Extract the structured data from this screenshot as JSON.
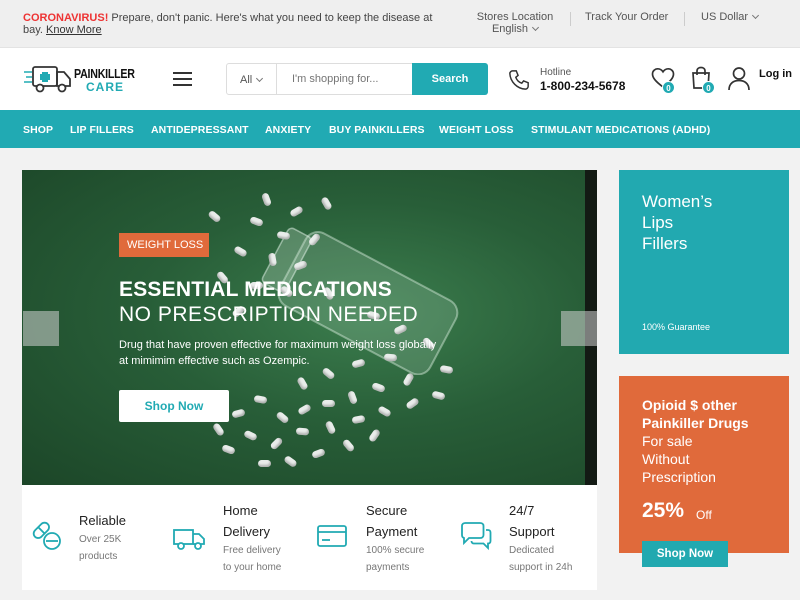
{
  "topbar": {
    "notice_strong": "CORONAVIRUS!",
    "notice_text": " Prepare, don't panic. Here's what you need to keep the disease at bay. ",
    "notice_link": "Know More",
    "stores_location": "Stores Location",
    "language": "English",
    "track_order": "Track Your Order",
    "currency": "US Dollar"
  },
  "header": {
    "logo_line1": "PAINKILLER",
    "logo_line2": "CARE",
    "search_category": "All",
    "search_placeholder": "I'm shopping for...",
    "search_button": "Search",
    "hotline_label": "Hotline",
    "hotline_number": "1-800-234-5678",
    "wishlist_count": "0",
    "cart_count": "0",
    "login_label": "Log in"
  },
  "nav": {
    "items": [
      "SHOP",
      "LIP FILLERS",
      "ANTIDEPRESSANT",
      "ANXIETY",
      "BUY PAINKILLERS",
      "WEIGHT LOSS",
      "STIMULANT MEDICATIONS (ADHD)"
    ]
  },
  "hero": {
    "tag": "WEIGHT LOSS",
    "title_line1": "ESSENTIAL MEDICATIONS",
    "title_line2": "NO PRESCRIPTION NEEDED",
    "description": "Drug that have proven effective for maximum weight loss globally  at mimimim effective such as Ozempic.",
    "button": "Shop Now"
  },
  "features": [
    {
      "title": "Reliable",
      "sub1": "Over 25K",
      "sub2": "products"
    },
    {
      "title1": "Home",
      "title2": "Delivery",
      "sub1": "Free delivery",
      "sub2": "to your home"
    },
    {
      "title1": "Secure",
      "title2": "Payment",
      "sub1": "100% secure",
      "sub2": "payments"
    },
    {
      "title1": "24/7",
      "title2": "Support",
      "sub1": "Dedicated",
      "sub2": "support in 24h"
    }
  ],
  "promo1": {
    "title_line1": "Women’s",
    "title_line2": "Lips",
    "title_line3": "Fillers",
    "subtitle": "100% Guarantee"
  },
  "promo2": {
    "title_line1": "Opioid $ other",
    "title_line2": "Painkiller Drugs",
    "sub_line1": "For sale",
    "sub_line2": "Without",
    "sub_line3": "Prescription",
    "percent": "25%",
    "off": "Off",
    "button": "Shop Now"
  },
  "colors": {
    "teal": "#21aab3",
    "orange": "#e06a3b",
    "hero_green": "#285e38"
  }
}
